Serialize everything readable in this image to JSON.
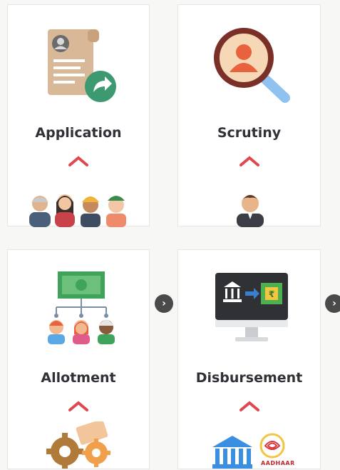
{
  "steps": [
    {
      "title": "Application",
      "icon": "document-share-icon",
      "footer_icon": "people-group-icon"
    },
    {
      "title": "Scrutiny",
      "icon": "magnifier-person-icon",
      "footer_icon": "officer-avatar-icon"
    },
    {
      "title": "Allotment",
      "icon": "money-allocation-icon",
      "footer_icon": "gears-document-icon"
    },
    {
      "title": "Disbursement",
      "icon": "bank-transfer-monitor-icon",
      "footer_icon": "bank-aadhaar-icon"
    }
  ],
  "aadhaar_label": "AADHAAR",
  "next_arrow": "›",
  "colors": {
    "accent_caret": "#e0484f",
    "title_text": "#2f3137",
    "card_bg": "#ffffff",
    "arrow_bg": "#4a4a4a"
  }
}
